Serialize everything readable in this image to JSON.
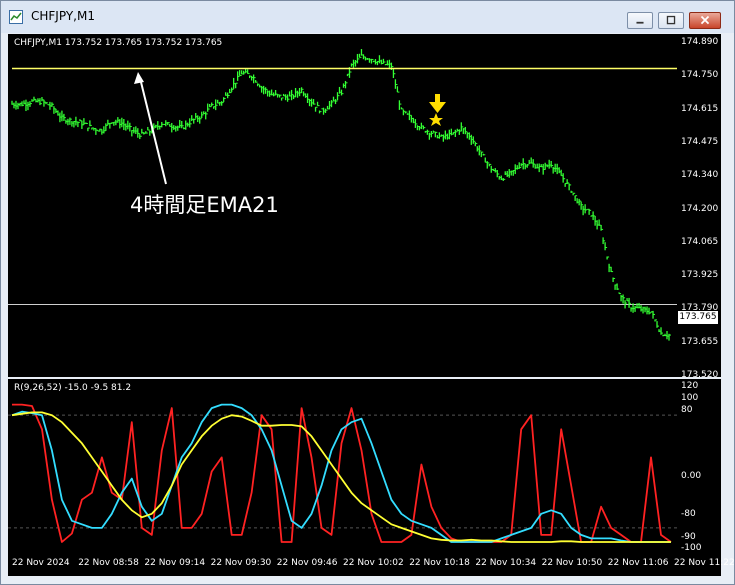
{
  "window": {
    "title": "CHFJPY,M1"
  },
  "chart": {
    "header": "CHFJPY,M1  173.752 173.765 173.752 173.765",
    "annotation": "4時間足EMA21",
    "current_price": "173.765",
    "subwindow_header": "R(9,26,52) -15.0 -9.5 81.2",
    "colors": {
      "background": "#000000",
      "candles": "#33ff33",
      "ema_line": "#ffff66",
      "level_line": "#cfcfcf",
      "signal_arrow": "#ffdd00",
      "rci_short": "#ff2222",
      "rci_mid": "#33ddff",
      "rci_long": "#ffff33",
      "text": "#ffffff"
    },
    "price_axis": [
      "174.890",
      "174.750",
      "174.615",
      "174.475",
      "174.340",
      "174.200",
      "174.065",
      "173.925",
      "173.790",
      "173.655",
      "173.520"
    ],
    "sub_axis": [
      "120",
      "100",
      "80",
      "0.00",
      "-80",
      "-90",
      "-100"
    ],
    "time_axis": [
      "22 Nov 2024",
      "22 Nov 08:58",
      "22 Nov 09:14",
      "22 Nov 09:30",
      "22 Nov 09:46",
      "22 Nov 10:02",
      "22 Nov 10:18",
      "22 Nov 10:34",
      "22 Nov 10:50",
      "22 Nov 11:06",
      "22 Nov 11:22"
    ]
  },
  "chart_data": [
    {
      "type": "line",
      "title": "CHFJPY,M1",
      "ylim": [
        173.52,
        174.89
      ],
      "series": [
        {
          "name": "",
          "x": [
            0,
            10,
            20,
            30,
            40,
            50,
            60,
            70,
            80,
            90,
            100,
            110,
            120,
            130,
            140,
            150,
            160,
            170,
            180,
            190,
            200,
            210,
            220,
            230,
            240,
            250,
            260,
            270,
            280,
            290,
            300,
            310,
            320,
            330,
            340,
            350,
            360,
            370,
            380,
            390,
            400,
            410,
            420,
            430,
            440,
            450,
            460,
            470,
            480,
            490,
            500,
            510,
            520,
            530,
            540,
            550,
            560,
            570,
            580,
            590,
            600,
            610,
            620,
            630,
            640,
            650,
            660
          ],
          "values": [
            174.63,
            174.63,
            174.64,
            174.64,
            174.62,
            174.57,
            174.56,
            174.55,
            174.53,
            174.52,
            174.56,
            174.55,
            174.52,
            174.5,
            174.52,
            174.55,
            174.54,
            174.53,
            174.56,
            174.58,
            174.62,
            174.64,
            174.7,
            174.76,
            174.75,
            174.7,
            174.67,
            174.66,
            174.66,
            174.69,
            174.64,
            174.6,
            174.63,
            174.68,
            174.79,
            174.83,
            174.82,
            174.8,
            174.79,
            174.6,
            174.57,
            174.53,
            174.51,
            174.49,
            174.5,
            174.53,
            174.49,
            174.42,
            174.36,
            174.32,
            174.34,
            174.38,
            174.38,
            174.36,
            174.38,
            174.33,
            174.27,
            174.2,
            174.17,
            174.1,
            173.92,
            173.82,
            173.78,
            173.77,
            173.76,
            173.67,
            173.66
          ]
        },
        {
          "name": "",
          "x": [
            0,
            660
          ],
          "values": [
            174.779,
            174.779
          ]
        }
      ]
    },
    {
      "type": "line",
      "title": "R(9,26,52)",
      "ylim": [
        -110,
        120
      ],
      "series": [
        {
          "name": "",
          "x": [
            0,
            10,
            20,
            30,
            40,
            50,
            60,
            70,
            80,
            90,
            100,
            110,
            120,
            130,
            140,
            150,
            160,
            170,
            180,
            190,
            200,
            210,
            220,
            230,
            240,
            250,
            260,
            270,
            280,
            290,
            300,
            310,
            320,
            330,
            340,
            350,
            360,
            370,
            380,
            390,
            400,
            410,
            420,
            430,
            440,
            450,
            460,
            470,
            480,
            490,
            500,
            510,
            520,
            530,
            540,
            550,
            560,
            570,
            580,
            590,
            600,
            610,
            620,
            630,
            640,
            650,
            660
          ],
          "values": [
            95,
            95,
            93,
            60,
            -40,
            -100,
            -88,
            -40,
            -30,
            20,
            -30,
            -40,
            70,
            -80,
            -90,
            30,
            90,
            -80,
            -80,
            -60,
            0,
            20,
            -90,
            -90,
            -30,
            80,
            60,
            -100,
            -100,
            90,
            20,
            -80,
            -90,
            40,
            90,
            30,
            -60,
            -100,
            -100,
            -100,
            -90,
            10,
            -50,
            -80,
            -95,
            -100,
            -100,
            -100,
            -100,
            -100,
            -90,
            60,
            80,
            -90,
            -90,
            60,
            -20,
            -100,
            -100,
            -50,
            -80,
            -90,
            -100,
            -100,
            20,
            -90,
            -100
          ]
        },
        {
          "name": "",
          "x": [
            0,
            10,
            20,
            30,
            40,
            50,
            60,
            70,
            80,
            90,
            100,
            110,
            120,
            130,
            140,
            150,
            160,
            170,
            180,
            190,
            200,
            210,
            220,
            230,
            240,
            250,
            260,
            270,
            280,
            290,
            300,
            310,
            320,
            330,
            340,
            350,
            360,
            370,
            380,
            390,
            400,
            410,
            420,
            430,
            440,
            450,
            460,
            470,
            480,
            490,
            500,
            510,
            520,
            530,
            540,
            550,
            560,
            570,
            580,
            590,
            600,
            610,
            620,
            630,
            640,
            650,
            660
          ],
          "values": [
            80,
            85,
            83,
            80,
            30,
            -40,
            -70,
            -75,
            -80,
            -80,
            -60,
            -30,
            -10,
            -50,
            -70,
            -60,
            -20,
            20,
            40,
            70,
            90,
            95,
            95,
            90,
            80,
            60,
            30,
            -20,
            -70,
            -80,
            -60,
            -20,
            30,
            60,
            70,
            75,
            40,
            0,
            -40,
            -60,
            -70,
            -75,
            -80,
            -90,
            -100,
            -100,
            -100,
            -100,
            -100,
            -95,
            -90,
            -85,
            -80,
            -60,
            -55,
            -60,
            -80,
            -90,
            -95,
            -95,
            -95,
            -98,
            -100,
            -100,
            -100,
            -100,
            -100
          ]
        },
        {
          "name": "",
          "x": [
            0,
            10,
            20,
            30,
            40,
            50,
            60,
            70,
            80,
            90,
            100,
            110,
            120,
            130,
            140,
            150,
            160,
            170,
            180,
            190,
            200,
            210,
            220,
            230,
            240,
            250,
            260,
            270,
            280,
            290,
            300,
            310,
            320,
            330,
            340,
            350,
            360,
            370,
            380,
            390,
            400,
            410,
            420,
            430,
            440,
            450,
            460,
            470,
            480,
            490,
            500,
            510,
            520,
            530,
            540,
            550,
            560,
            570,
            580,
            590,
            600,
            610,
            620,
            630,
            640,
            650,
            660
          ],
          "values": [
            80,
            82,
            84,
            84,
            80,
            70,
            55,
            40,
            20,
            0,
            -20,
            -40,
            -55,
            -65,
            -60,
            -45,
            -20,
            10,
            30,
            50,
            65,
            75,
            80,
            78,
            72,
            65,
            65,
            66,
            66,
            64,
            50,
            30,
            10,
            -10,
            -30,
            -45,
            -55,
            -65,
            -75,
            -80,
            -85,
            -90,
            -95,
            -97,
            -98,
            -98,
            -97,
            -98,
            -98,
            -99,
            -100,
            -100,
            -100,
            -100,
            -100,
            -99,
            -99,
            -100,
            -100,
            -100,
            -100,
            -100,
            -100,
            -100,
            -100,
            -100,
            -100
          ]
        }
      ]
    }
  ]
}
